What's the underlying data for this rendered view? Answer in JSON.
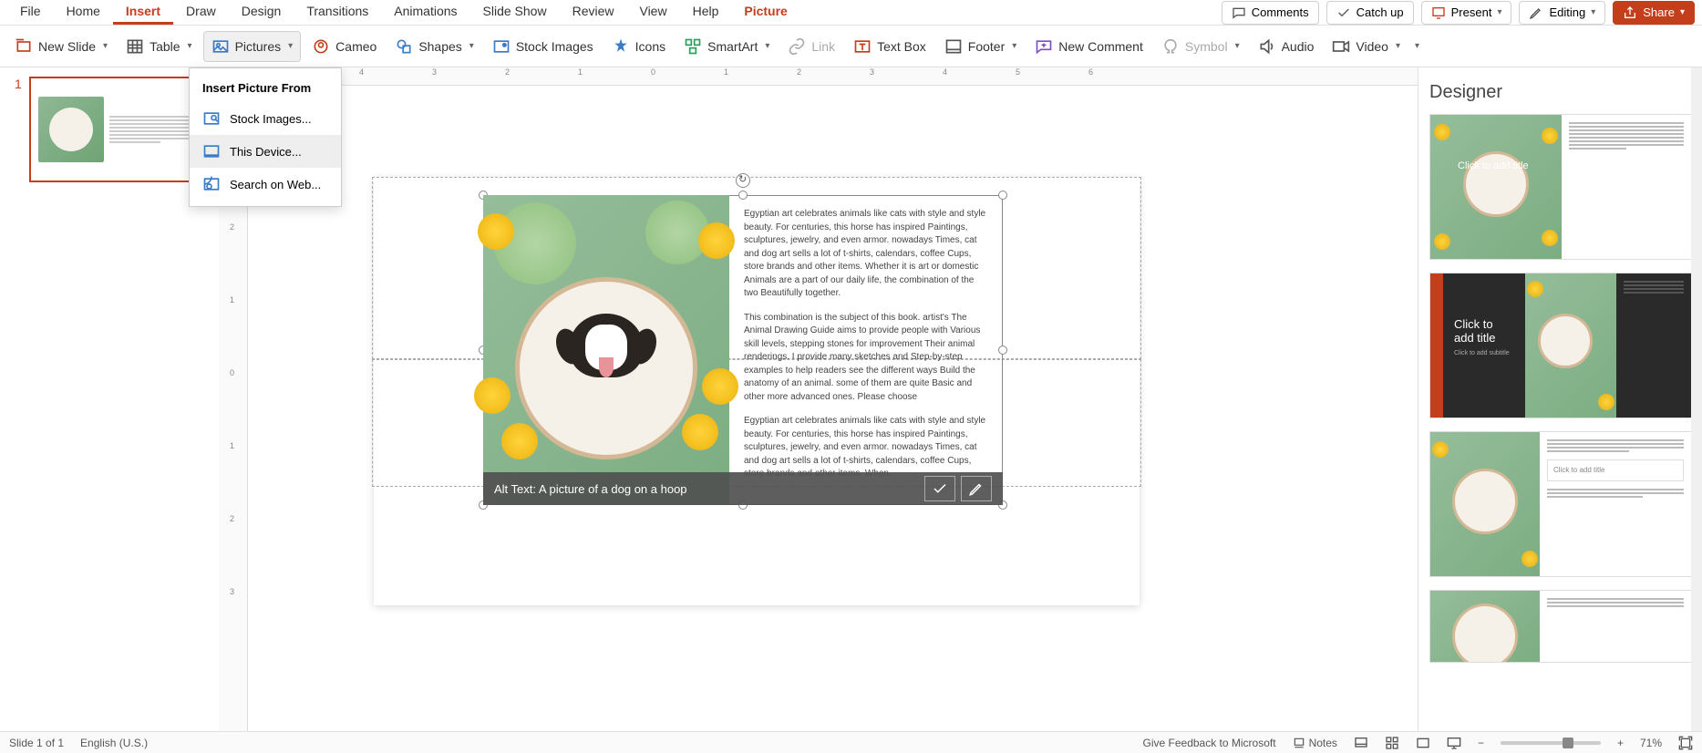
{
  "menubar": {
    "tabs": [
      "File",
      "Home",
      "Insert",
      "Draw",
      "Design",
      "Transitions",
      "Animations",
      "Slide Show",
      "Review",
      "View",
      "Help",
      "Picture"
    ],
    "active": "Insert",
    "contextual": "Picture",
    "comments": "Comments",
    "catchup": "Catch up",
    "present": "Present",
    "editing": "Editing",
    "share": "Share"
  },
  "ribbon": {
    "newslide": "New Slide",
    "table": "Table",
    "pictures": "Pictures",
    "cameo": "Cameo",
    "shapes": "Shapes",
    "stock": "Stock Images",
    "icons": "Icons",
    "smartart": "SmartArt",
    "link": "Link",
    "textbox": "Text Box",
    "footer": "Footer",
    "newcomment": "New Comment",
    "symbol": "Symbol",
    "audio": "Audio",
    "video": "Video"
  },
  "dropdown": {
    "header": "Insert Picture From",
    "stock": "Stock Images...",
    "device": "This Device...",
    "web": "Search on Web..."
  },
  "thumbnails": {
    "num1": "1"
  },
  "slide": {
    "para1": "Egyptian art celebrates animals like cats with style and style beauty. For centuries, this horse has inspired Paintings, sculptures, jewelry, and even armor. nowadays Times, cat and dog art sells a lot of t-shirts, calendars, coffee Cups, store brands and other items. Whether it is art or domestic Animals are a part of our daily life, the combination of the two Beautifully together.",
    "para2": "This combination is the subject of this book. artist's The Animal Drawing Guide aims to provide people with Various skill levels, stepping stones for improvement Their animal renderings. I provide many sketches and Step-by-step examples to help readers see the different ways Build the anatomy of an animal. some of them are quite Basic and other more advanced ones. Please choose",
    "para3": "Egyptian art celebrates animals like cats with style and style beauty. For centuries, this horse has inspired Paintings, sculptures, jewelry, and even armor. nowadays Times, cat and dog art sells a lot of t-shirts, calendars, coffee Cups, store brands and other items. When",
    "alttext": "Alt Text: A picture of a dog on a hoop"
  },
  "designer": {
    "title": "Designer",
    "card1_overlay": "Click to add title",
    "card2_title": "Click to add title",
    "card2_sub": "Click to add subtitle",
    "card3_overlay": "Click to add title"
  },
  "statusbar": {
    "slide": "Slide 1 of 1",
    "lang": "English (U.S.)",
    "feedback": "Give Feedback to Microsoft",
    "notes": "Notes",
    "zoom": "71%"
  }
}
